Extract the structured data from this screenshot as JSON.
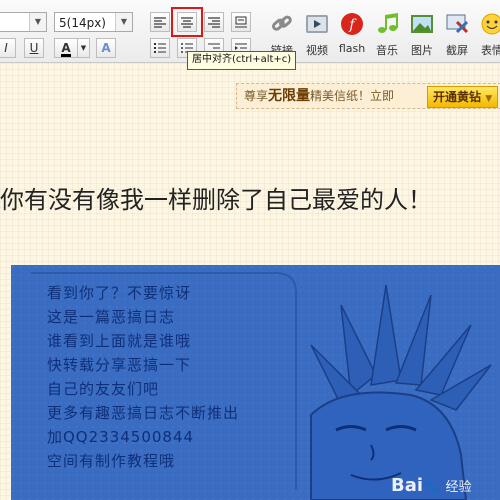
{
  "toolbar": {
    "font_name_value": "",
    "font_size_value": "5(14px)",
    "italic_label": "I",
    "underline_label": "U",
    "font_color_label": "A",
    "highlight_label": "A",
    "tools": [
      {
        "label": "链接"
      },
      {
        "label": "视频"
      },
      {
        "label": "flash"
      },
      {
        "label": "音乐"
      },
      {
        "label": "图片"
      },
      {
        "label": "截屏"
      },
      {
        "label": "表情"
      }
    ],
    "tooltip": "居中对齐(ctrl+alt+c)"
  },
  "promo": {
    "prefix": "尊享",
    "highlight": "无限量",
    "suffix": "精美信纸！立即",
    "button": "开通黄钻"
  },
  "post": {
    "title": "你有没有像我一样删除了自己最爱的人！"
  },
  "cartoon": {
    "lines": [
      "看到你了？不要惊讶",
      "这是一篇恶搞日志",
      "谁看到上面就是谁哦",
      "快转载分享恶搞一下",
      "自己的友友们吧",
      "更多有趣恶搞日志不断推出",
      "加QQ2334500844",
      "空间有制作教程哦"
    ]
  },
  "watermark": {
    "brand": "Bai",
    "suffix": "经验"
  },
  "colors": {
    "accent_red": "#e21414",
    "cartoon_bg": "#3a6dc2"
  }
}
